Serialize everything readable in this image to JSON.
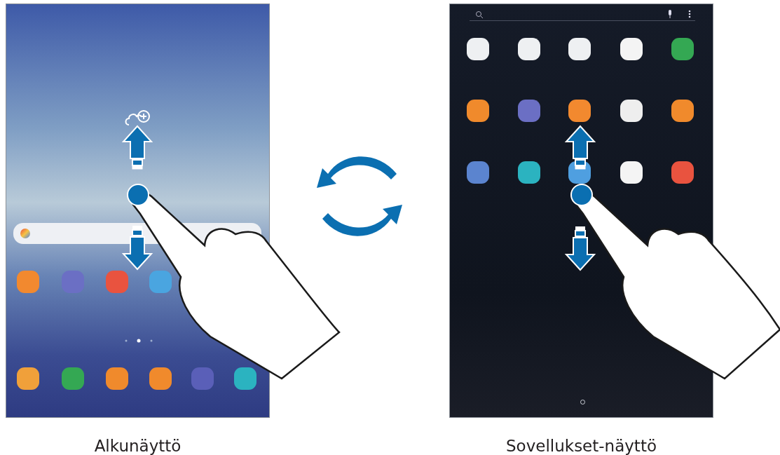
{
  "screens": [
    {
      "kind": "home",
      "caption": "Alkunäyttö"
    },
    {
      "kind": "apps",
      "caption": "Sovellukset-näyttö"
    }
  ]
}
